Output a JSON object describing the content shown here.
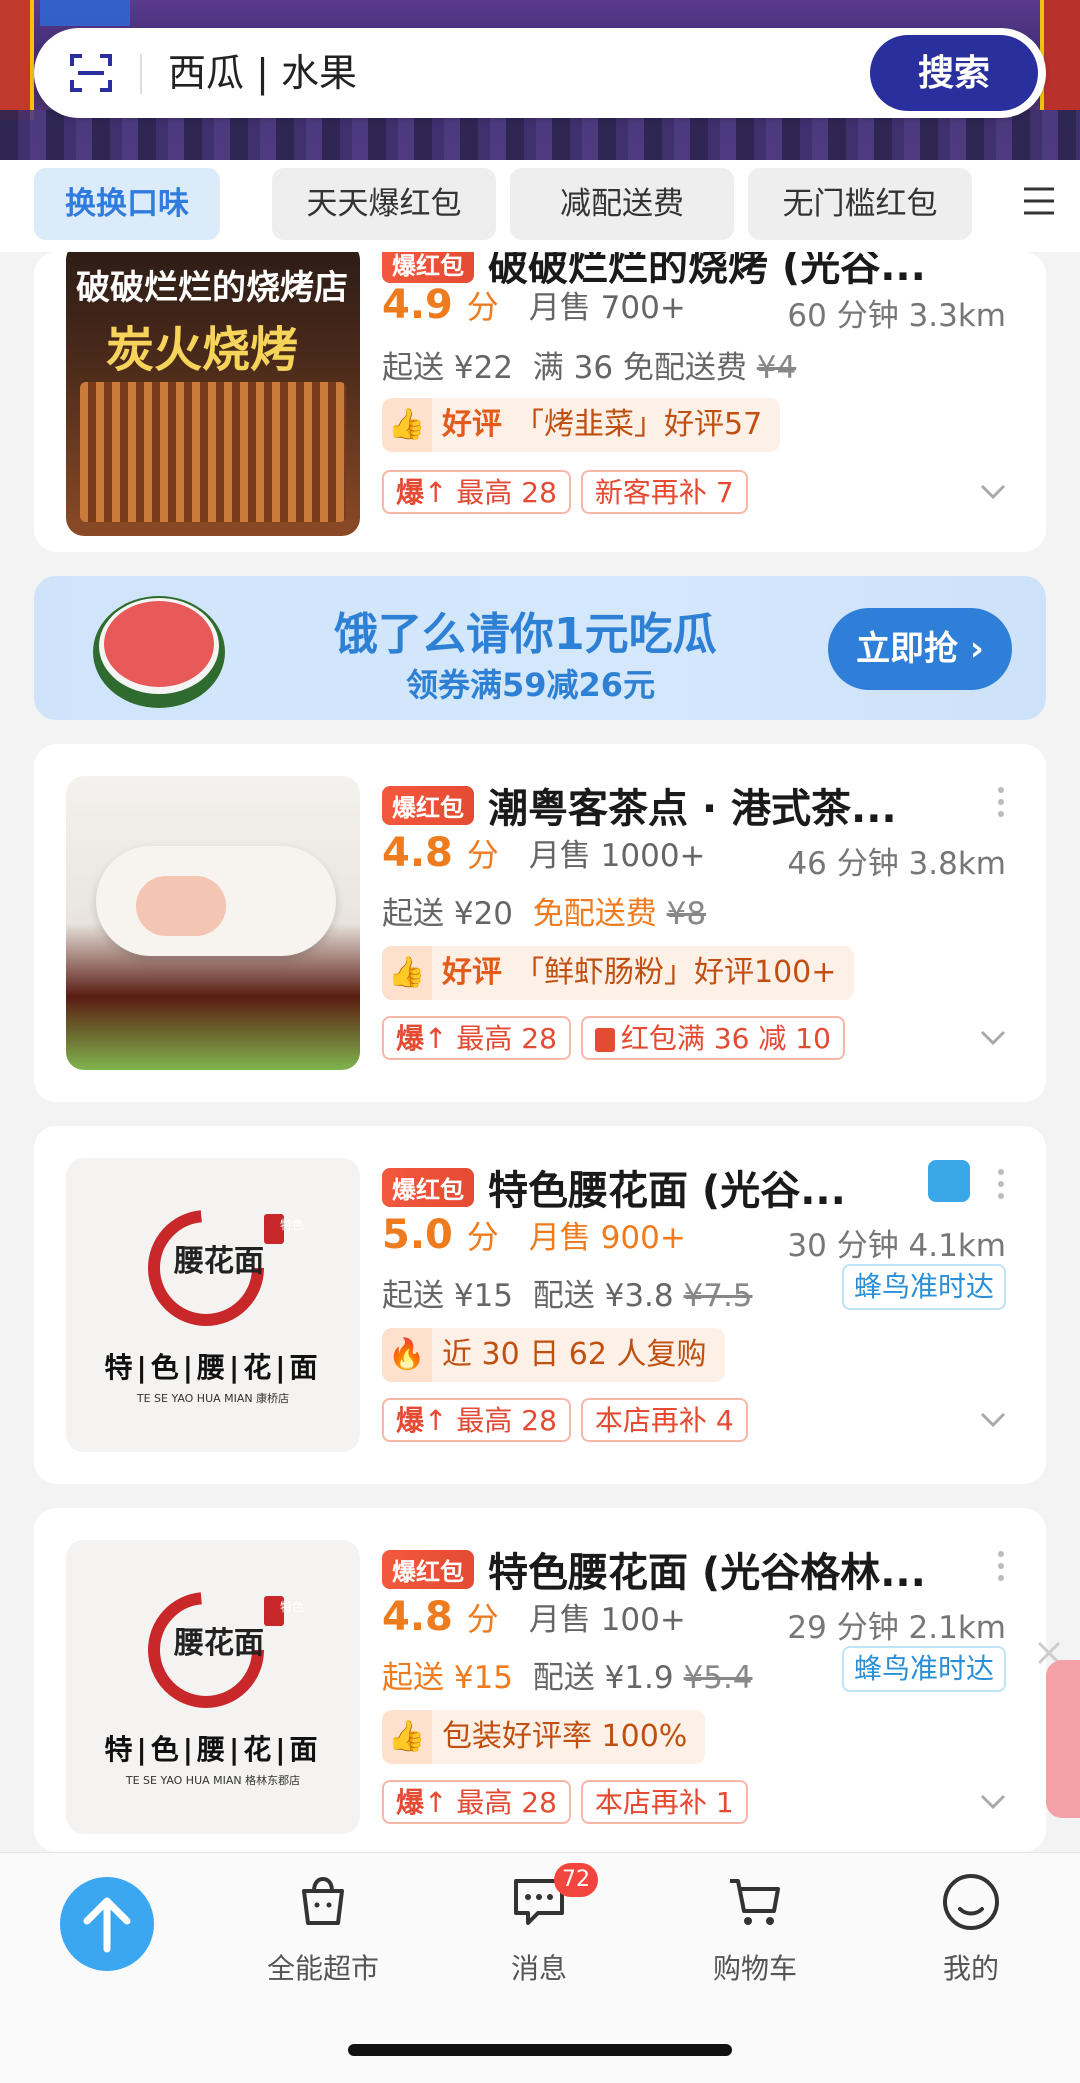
{
  "search": {
    "value": "西瓜 | 水果",
    "button": "搜索"
  },
  "tabs": [
    "换换口味",
    "天天爆红包",
    "减配送费",
    "无门槛红包"
  ],
  "stores": [
    {
      "thumb_lines": [
        "破破烂烂的烧烤店",
        "炭火烧烤"
      ],
      "hot": "爆红包",
      "name": "破破烂烂的烧烤 (光谷...",
      "score": "4.9",
      "score_unit": "分",
      "sales": "月售 700+",
      "time_dist": "60 分钟 3.3km",
      "min_order": "起送 ¥22",
      "delivery": "满 36 免配送费",
      "delivery_old": "¥4",
      "pill_label": "好评",
      "pill_text": "「烤韭菜」好评57",
      "coupons": [
        {
          "icon": "爆",
          "text": "最高 28"
        },
        {
          "text": "新客再补 7"
        }
      ]
    },
    {
      "hot": "爆红包",
      "name": "潮粤客茶点 · 港式茶...",
      "score": "4.8",
      "score_unit": "分",
      "sales": "月售 1000+",
      "time_dist": "46 分钟 3.8km",
      "min_order": "起送 ¥20",
      "delivery": "免配送费",
      "delivery_old": "¥8",
      "pill_label": "好评",
      "pill_text": "「鲜虾肠粉」好评100+",
      "coupons": [
        {
          "icon": "爆",
          "text": "最高 28"
        },
        {
          "text": "红包满 36 减 10"
        }
      ]
    },
    {
      "thumb_logo": "腰花面",
      "thumb_tag": "特色",
      "thumb_title": "特|色|腰|花|面",
      "thumb_sub": "TE SE YAO HUA MIAN 康桥店",
      "hot": "爆红包",
      "name": "特色腰花面 (光谷...",
      "score": "5.0",
      "score_unit": "分",
      "sales": "月售 900+",
      "time_dist": "30 分钟 4.1km",
      "min_order": "起送 ¥15",
      "delivery": "配送 ¥3.8",
      "delivery_old": "¥7.5",
      "fn_badge": "蜂鸟准时达",
      "pill_text": "近 30 日 62 人复购",
      "coupons": [
        {
          "icon": "爆",
          "text": "最高 28"
        },
        {
          "text": "本店再补 4"
        }
      ]
    },
    {
      "thumb_logo": "腰花面",
      "thumb_tag": "特色",
      "thumb_title": "特|色|腰|花|面",
      "thumb_sub": "TE SE YAO HUA MIAN 格林东郡店",
      "hot": "爆红包",
      "name": "特色腰花面 (光谷格林...",
      "score": "4.8",
      "score_unit": "分",
      "sales": "月售 100+",
      "time_dist": "29 分钟 2.1km",
      "min_order": "起送 ¥15",
      "delivery": "配送 ¥1.9",
      "delivery_old": "¥5.4",
      "fn_badge": "蜂鸟准时达",
      "pill_text": "包装好评率 100%",
      "coupons": [
        {
          "icon": "爆",
          "text": "最高 28"
        },
        {
          "text": "本店再补 1"
        }
      ]
    }
  ],
  "banner": {
    "title": "饿了么请你1元吃瓜",
    "subtitle": "领券满59减26元",
    "button": "立即抢 ›"
  },
  "nav": {
    "items": [
      "全能超市",
      "消息",
      "购物车",
      "我的"
    ],
    "msg_count": "72"
  }
}
